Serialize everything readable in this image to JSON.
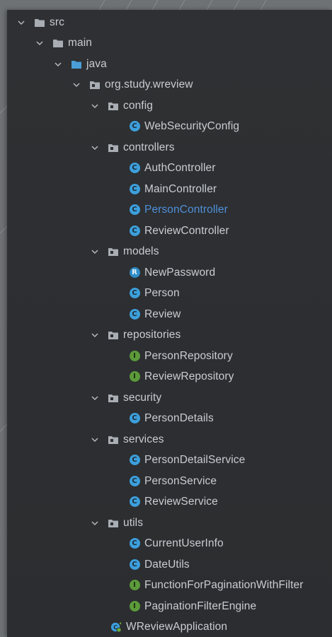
{
  "colors": {
    "panel_bg": "#2b2d30",
    "text": "#c9ccd1",
    "selected_text": "#4f8fd8",
    "class_icon": "#3c9fdc",
    "interface_icon": "#5c9a3a",
    "folder_icon": "#a9aeb4",
    "source_folder_icon": "#4a9ed8"
  },
  "tree": [
    {
      "label": "src",
      "kind": "folder",
      "expanded": true
    },
    {
      "label": "main",
      "kind": "folder",
      "expanded": true
    },
    {
      "label": "java",
      "kind": "source-folder",
      "expanded": true
    },
    {
      "label": "org.study.wreview",
      "kind": "package",
      "expanded": true
    },
    {
      "label": "config",
      "kind": "package",
      "expanded": true
    },
    {
      "label": "WebSecurityConfig",
      "kind": "class"
    },
    {
      "label": "controllers",
      "kind": "package",
      "expanded": true
    },
    {
      "label": "AuthController",
      "kind": "class"
    },
    {
      "label": "MainController",
      "kind": "class"
    },
    {
      "label": "PersonController",
      "kind": "class",
      "selected": true
    },
    {
      "label": "ReviewController",
      "kind": "class"
    },
    {
      "label": "models",
      "kind": "package",
      "expanded": true
    },
    {
      "label": "NewPassword",
      "kind": "record"
    },
    {
      "label": "Person",
      "kind": "class"
    },
    {
      "label": "Review",
      "kind": "class"
    },
    {
      "label": "repositories",
      "kind": "package",
      "expanded": true
    },
    {
      "label": "PersonRepository",
      "kind": "interface"
    },
    {
      "label": "ReviewRepository",
      "kind": "interface"
    },
    {
      "label": "security",
      "kind": "package",
      "expanded": true
    },
    {
      "label": "PersonDetails",
      "kind": "class"
    },
    {
      "label": "services",
      "kind": "package",
      "expanded": true
    },
    {
      "label": "PersonDetailService",
      "kind": "class"
    },
    {
      "label": "PersonService",
      "kind": "class"
    },
    {
      "label": "ReviewService",
      "kind": "class"
    },
    {
      "label": "utils",
      "kind": "package",
      "expanded": true
    },
    {
      "label": "CurrentUserInfo",
      "kind": "class"
    },
    {
      "label": "DateUtils",
      "kind": "class"
    },
    {
      "label": "FunctionForPaginationWithFilter",
      "kind": "interface"
    },
    {
      "label": "PaginationFilterEngine",
      "kind": "interface"
    },
    {
      "label": "WReviewApplication",
      "kind": "spring-app"
    }
  ]
}
